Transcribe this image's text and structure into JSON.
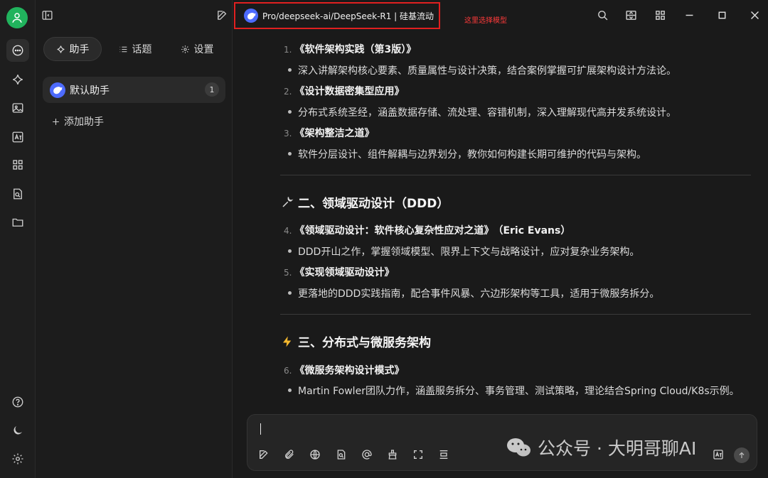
{
  "sidebar_tabs": [
    {
      "label": "助手",
      "icon": "sparkle-icon"
    },
    {
      "label": "话题",
      "icon": "list-icon"
    },
    {
      "label": "设置",
      "icon": "gear-icon"
    }
  ],
  "assistant": {
    "name": "默认助手",
    "topic_count": "1"
  },
  "add_assistant_label": "添加助手",
  "model_selector": {
    "label": "Pro/deepseek-ai/DeepSeek-R1 | 硅基流动"
  },
  "annotation": "这里选择模型",
  "content": {
    "items": [
      {
        "num": "1.",
        "title": "《软件架构实践（第3版）》",
        "author": "",
        "desc": "深入讲解架构核心要素、质量属性与设计决策，结合案例掌握可扩展架构设计方法论。"
      },
      {
        "num": "2.",
        "title": "《设计数据密集型应用》",
        "author": "",
        "desc": "分布式系统圣经，涵盖数据存储、流处理、容错机制，深入理解现代高并发系统设计。"
      },
      {
        "num": "3.",
        "title": "《架构整洁之道》",
        "author": "",
        "desc": "软件分层设计、组件解耦与边界划分，教你如何构建长期可维护的代码与架构。"
      },
      {
        "num": "4.",
        "title": "《领域驱动设计：软件核心复杂性应对之道》",
        "author": "（Eric Evans）",
        "desc": "DDD开山之作，掌握领域模型、限界上下文与战略设计，应对复杂业务架构。"
      },
      {
        "num": "5.",
        "title": "《实现领域驱动设计》",
        "author": "",
        "desc": "更落地的DDD实践指南，配合事件风暴、六边形架构等工具，适用于微服务拆分。"
      },
      {
        "num": "6.",
        "title": "《微服务架构设计模式》",
        "author": "",
        "desc": "Martin Fowler团队力作，涵盖服务拆分、事务管理、测试策略，理论结合Spring Cloud/K8s示例。"
      }
    ],
    "sections": [
      {
        "title": "二、领域驱动设计（DDD）",
        "icon": "wrench-icon"
      },
      {
        "title": "三、分布式与微服务架构",
        "icon": "lightning-icon"
      }
    ]
  },
  "watermark": {
    "text": "公众号 · 大明哥聊AI"
  },
  "colors": {
    "accent_green": "#21b35d",
    "deepseek_blue": "#4d6bfe",
    "annotation_red": "#e02020"
  }
}
